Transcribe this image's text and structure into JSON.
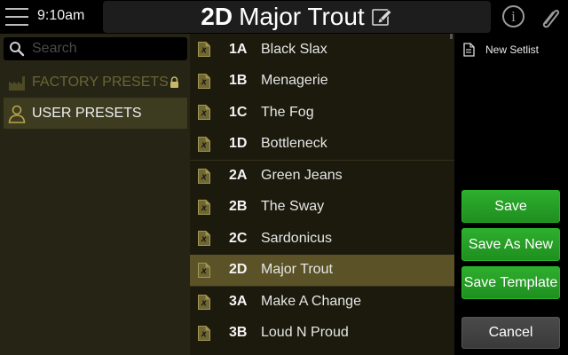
{
  "header": {
    "time": "9:10am",
    "preset_id": "2D",
    "preset_name": "Major Trout",
    "info_label": "i",
    "icons": [
      "hamburger-menu-icon",
      "edit-pencil-icon",
      "info-icon",
      "paperclip-icon"
    ]
  },
  "search": {
    "placeholder": "Search",
    "value": ""
  },
  "categories": [
    {
      "label": "FACTORY PRESETS",
      "locked": true,
      "selected": false
    },
    {
      "label": "USER PRESETS",
      "locked": false,
      "selected": true
    }
  ],
  "presets": [
    {
      "id": "1A",
      "name": "Black Slax",
      "selected": false
    },
    {
      "id": "1B",
      "name": "Menagerie",
      "selected": false
    },
    {
      "id": "1C",
      "name": "The Fog",
      "selected": false
    },
    {
      "id": "1D",
      "name": "Bottleneck",
      "selected": false
    },
    {
      "id": "2A",
      "name": "Green Jeans",
      "selected": false
    },
    {
      "id": "2B",
      "name": "The Sway",
      "selected": false
    },
    {
      "id": "2C",
      "name": "Sardonicus",
      "selected": false
    },
    {
      "id": "2D",
      "name": "Major Trout",
      "selected": true
    },
    {
      "id": "3A",
      "name": "Make A Change",
      "selected": false
    },
    {
      "id": "3B",
      "name": "Loud N Proud",
      "selected": false
    }
  ],
  "actions": {
    "new_setlist": "New Setlist",
    "save": "Save",
    "save_as_new": "Save As New",
    "save_template": "Save Template",
    "cancel": "Cancel"
  },
  "colors": {
    "accent_selected": "#5b5327",
    "save_green": "#26a026",
    "cancel_gray": "#424242",
    "locked_text": "#6b6535"
  }
}
